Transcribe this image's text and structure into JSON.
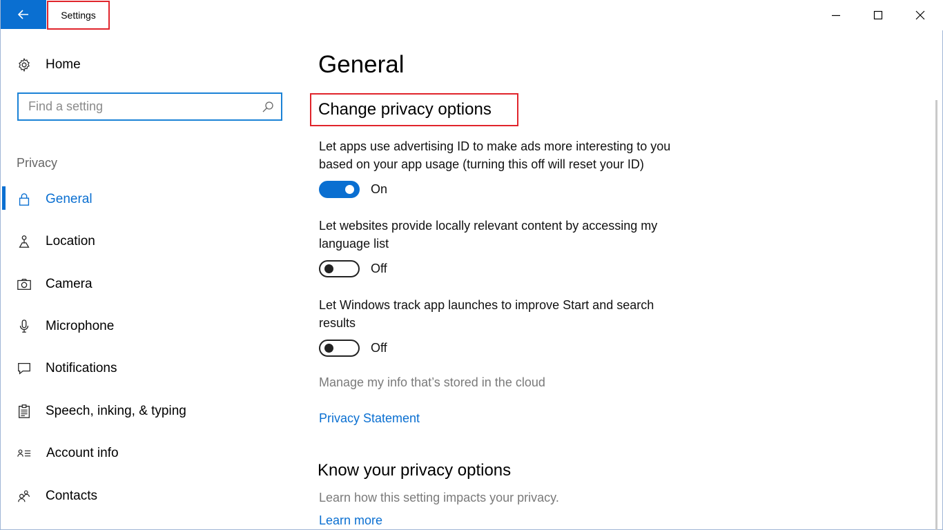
{
  "window": {
    "title": "Settings"
  },
  "sidebar": {
    "home_label": "Home",
    "search_placeholder": "Find a setting",
    "section_label": "Privacy",
    "items": [
      {
        "label": "General",
        "icon": "lock-icon",
        "active": true
      },
      {
        "label": "Location",
        "icon": "location-icon"
      },
      {
        "label": "Camera",
        "icon": "camera-icon"
      },
      {
        "label": "Microphone",
        "icon": "microphone-icon"
      },
      {
        "label": "Notifications",
        "icon": "notifications-icon"
      },
      {
        "label": "Speech, inking, & typing",
        "icon": "clipboard-icon"
      },
      {
        "label": "Account info",
        "icon": "account-info-icon"
      },
      {
        "label": "Contacts",
        "icon": "contacts-icon"
      }
    ]
  },
  "main": {
    "page_title": "General",
    "section_title": "Change privacy options",
    "options": [
      {
        "description_line1": "Let apps use advertising ID to make ads more interesting to you",
        "description_line2": "based on your app usage (turning this off will reset your ID)",
        "state": "On"
      },
      {
        "description_line1": "Let websites provide locally relevant content by accessing my",
        "description_line2": "language list",
        "state": "Off"
      },
      {
        "description_line1": "Let Windows track app launches to improve Start and search",
        "description_line2": "results",
        "state": "Off"
      }
    ],
    "cloud_link": "Manage my info that’s stored in the cloud",
    "privacy_statement_link": "Privacy Statement",
    "know_title": "Know your privacy options",
    "know_desc": "Learn how this setting impacts your privacy.",
    "learn_more_link": "Learn more"
  },
  "colors": {
    "accent": "#0a6fd1",
    "highlight_box": "#e0242b"
  }
}
